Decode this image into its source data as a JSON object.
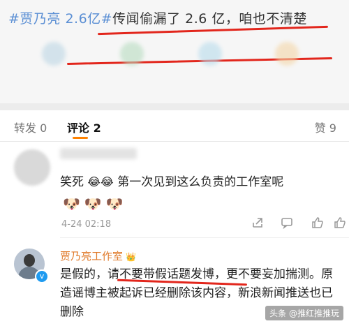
{
  "post": {
    "hashtag": "#贾乃亮 2.6亿#",
    "text": "传闻偷漏了 2.6 亿，咱也不清楚"
  },
  "tabs": {
    "repost": "转发 0",
    "comment": "评论 2",
    "like": "赞 9"
  },
  "comment1": {
    "text_before": "笑死",
    "emoji": "😂😂",
    "text_after": "第一次见到这么负责的工作室呢",
    "doges": "🐶🐶🐶",
    "time": "4-24 02:18",
    "actions": {
      "share_icon": "share-icon",
      "comment_icon": "comment-icon",
      "like_icon": "like-icon"
    }
  },
  "comment2": {
    "author": "贾乃亮工作室",
    "badge": "👑",
    "text": "是假的，请不要带假话题发博，更不要妄加揣测。原造谣博主被起诉已经删除该内容，新浪新闻推送也已删除"
  },
  "watermark": "头条 @推红推推玩"
}
